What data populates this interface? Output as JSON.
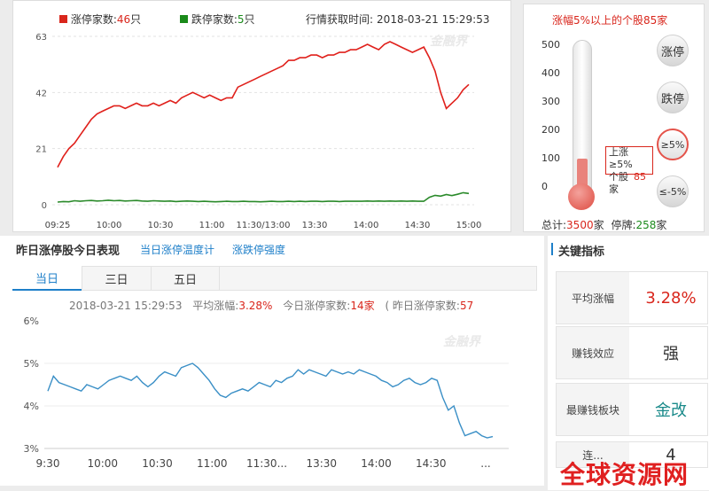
{
  "top": {
    "up_label": "涨停家数:",
    "up_value": "46",
    "unit": "只",
    "down_label": "跌停家数:",
    "down_value": "5",
    "fetch_time_label": "行情获取时间:",
    "fetch_time": "2018-03-21 15:29:53",
    "watermark": "金融界",
    "chart_data": {
      "type": "line",
      "x": [
        "09:25",
        "10:00",
        "10:30",
        "11:00",
        "11:30/13:00",
        "13:30",
        "14:00",
        "14:30",
        "15:00"
      ],
      "yticks": [
        0,
        21,
        42,
        63
      ],
      "ylim": [
        0,
        63
      ],
      "series": [
        {
          "color": "#e0201b",
          "values": [
            14,
            18,
            21,
            23,
            26,
            29,
            32,
            34,
            35,
            36,
            37,
            37,
            36,
            37,
            38,
            37,
            37,
            38,
            37,
            38,
            39,
            38,
            40,
            41,
            42,
            41,
            40,
            41,
            40,
            39,
            40,
            40,
            44,
            45,
            46,
            47,
            48,
            49,
            50,
            51,
            52,
            54,
            54,
            55,
            55,
            56,
            56,
            55,
            56,
            56,
            57,
            57,
            58,
            58,
            59,
            60,
            59,
            58,
            60,
            61,
            60,
            59,
            58,
            57,
            58,
            59,
            55,
            50,
            42,
            36,
            38,
            40,
            43,
            45
          ]
        },
        {
          "color": "#2a8a2a",
          "values": [
            1,
            1.2,
            1.1,
            1.5,
            1.3,
            1.5,
            1.6,
            1.4,
            1.5,
            1.7,
            1.5,
            1.6,
            1.4,
            1.5,
            1.6,
            1.4,
            1.3,
            1.5,
            1.4,
            1.3,
            1.4,
            1.2,
            1.3,
            1.4,
            1.3,
            1.2,
            1.3,
            1.2,
            1.1,
            1.2,
            1.3,
            1.2,
            1.2,
            1.3,
            1.2,
            1.2,
            1.1,
            1.2,
            1.3,
            1.2,
            1.2,
            1.3,
            1.2,
            1.3,
            1.2,
            1.3,
            1.3,
            1.2,
            1.3,
            1.3,
            1.2,
            1.3,
            1.3,
            1.3,
            1.3,
            1.4,
            1.3,
            1.4,
            1.3,
            1.4,
            1.3,
            1.4,
            1.3,
            1.4,
            1.3,
            1.3,
            2.8,
            3.5,
            3.2,
            3.8,
            3.4,
            3.9,
            4.5,
            4.2
          ]
        }
      ]
    }
  },
  "thermo": {
    "title": "涨幅5%以上的个股85家",
    "scale": [
      "500",
      "400",
      "300",
      "200",
      "100",
      "0"
    ],
    "fill_level": 85,
    "max_level": 500,
    "tooltip_line1": "上涨",
    "tooltip_line2": "≥5%",
    "tooltip_line3": "个股",
    "tooltip_value": "85",
    "tooltip_line4": "家",
    "buttons": [
      "涨停",
      "跌停",
      "≥5%",
      "≤-5%"
    ],
    "total_label": "总计:",
    "total_value": "3500",
    "total_unit": "家",
    "halt_label": "停牌:",
    "halt_value": "258",
    "halt_unit": "家"
  },
  "bottom": {
    "title": "昨日涨停股今日表现",
    "link1": "当日涨停温度计",
    "link2": "涨跌停强度",
    "tabs": [
      "当日",
      "三日",
      "五日"
    ],
    "info_time": "2018-03-21 15:29:53",
    "avg_label": "平均涨幅:",
    "avg_value": "3.28%",
    "today_label": "今日涨停家数:",
    "today_value": "14家",
    "yday_label": "( 昨日涨停家数:",
    "yday_value": "57",
    "watermark": "金融界",
    "chart_data": {
      "type": "line",
      "x": [
        "9:30",
        "10:00",
        "10:30",
        "11:00",
        "11:30...",
        "13:30",
        "14:00",
        "14:30",
        "..."
      ],
      "yticks": [
        "3%",
        "4%",
        "5%",
        "6%"
      ],
      "ylim": [
        3,
        6
      ],
      "series": [
        {
          "color": "#3a8fc6",
          "values": [
            4.35,
            4.7,
            4.55,
            4.5,
            4.45,
            4.4,
            4.35,
            4.5,
            4.45,
            4.4,
            4.5,
            4.6,
            4.65,
            4.7,
            4.65,
            4.6,
            4.7,
            4.55,
            4.45,
            4.55,
            4.7,
            4.8,
            4.75,
            4.7,
            4.9,
            4.95,
            5.0,
            4.9,
            4.75,
            4.6,
            4.4,
            4.25,
            4.2,
            4.3,
            4.35,
            4.4,
            4.35,
            4.45,
            4.55,
            4.5,
            4.45,
            4.6,
            4.55,
            4.65,
            4.7,
            4.85,
            4.75,
            4.85,
            4.8,
            4.75,
            4.7,
            4.85,
            4.8,
            4.75,
            4.8,
            4.75,
            4.85,
            4.8,
            4.75,
            4.7,
            4.6,
            4.55,
            4.45,
            4.5,
            4.6,
            4.65,
            4.55,
            4.5,
            4.55,
            4.65,
            4.6,
            4.2,
            3.9,
            4.0,
            3.6,
            3.3,
            3.35,
            3.4,
            3.3,
            3.25,
            3.28
          ]
        }
      ]
    }
  },
  "key": {
    "title": "关键指标",
    "cards": [
      {
        "label": "平均涨幅",
        "value": "3.28%",
        "color": "#d9261c"
      },
      {
        "label": "赚钱效应",
        "value": "强",
        "color": "#333333"
      },
      {
        "label": "最赚钱板块",
        "value": "金改",
        "color": "#1a8a8a"
      },
      {
        "label": "连...",
        "value": "4",
        "color": "#333333"
      }
    ]
  },
  "footer_watermark": "全球资源网"
}
